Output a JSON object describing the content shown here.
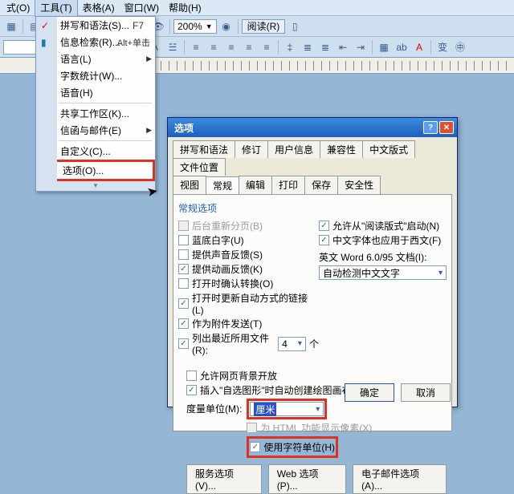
{
  "menubar": {
    "items": [
      "式(O)",
      "工具(T)",
      "表格(A)",
      "窗口(W)",
      "帮助(H)"
    ]
  },
  "toolbar": {
    "zoom": "200%",
    "read_btn": "阅读(R)"
  },
  "dropdown": {
    "items": [
      {
        "label": "拼写和语法(S)...",
        "shortcut": "F7"
      },
      {
        "label": "信息检索(R)...",
        "shortcut": "Alt+单击"
      },
      {
        "label": "语言(L)",
        "submenu": true
      },
      {
        "label": "字数统计(W)..."
      },
      {
        "label": "语音(H)"
      },
      {
        "label": "共享工作区(K)..."
      },
      {
        "label": "信函与邮件(E)",
        "submenu": true
      },
      {
        "label": "自定义(C)..."
      },
      {
        "label": "选项(O)...",
        "highlight": true
      }
    ]
  },
  "dialog": {
    "title": "选项",
    "tabs_row1": [
      "拼写和语法",
      "修订",
      "用户信息",
      "兼容性",
      "中文版式",
      "文件位置"
    ],
    "tabs_row2": [
      "视图",
      "常规",
      "编辑",
      "打印",
      "保存",
      "安全性"
    ],
    "active_tab": "常规",
    "section1_title": "常规选项",
    "left_checks": [
      {
        "label": "后台重新分页(B)",
        "checked": false,
        "disabled": true
      },
      {
        "label": "蓝底白字(U)",
        "checked": false
      },
      {
        "label": "提供声音反馈(S)",
        "checked": false
      },
      {
        "label": "提供动画反馈(K)",
        "checked": true
      },
      {
        "label": "打开时确认转换(O)",
        "checked": false
      },
      {
        "label": "打开时更新自动方式的链接(L)",
        "checked": true
      },
      {
        "label": "作为附件发送(T)",
        "checked": true
      }
    ],
    "recent_label_pre": "列出最近所用文件(R):",
    "recent_value": "4",
    "recent_label_post": "个",
    "right_checks": [
      {
        "label": "允许从\"阅读版式\"启动(N)",
        "checked": true
      },
      {
        "label": "中文字体也应用于西文(F)",
        "checked": true
      }
    ],
    "right_label": "英文 Word 6.0/95 文档(I):",
    "right_select": "自动检测中文文字",
    "section2_checks": [
      {
        "label": "允许网页背景开放",
        "checked": false
      },
      {
        "label": "插入\"自选图形\"时自动创建绘图画布(C)",
        "checked": true
      }
    ],
    "unit_label": "度量单位(M):",
    "unit_value": "厘米",
    "pixel_check": "为 HTML 功能显示像素(X)",
    "char_unit_check": "使用字符单位(H)",
    "svc_buttons": [
      "服务选项(V)...",
      "Web 选项(P)...",
      "电子邮件选项(A)..."
    ],
    "ok": "确定",
    "cancel": "取消"
  }
}
